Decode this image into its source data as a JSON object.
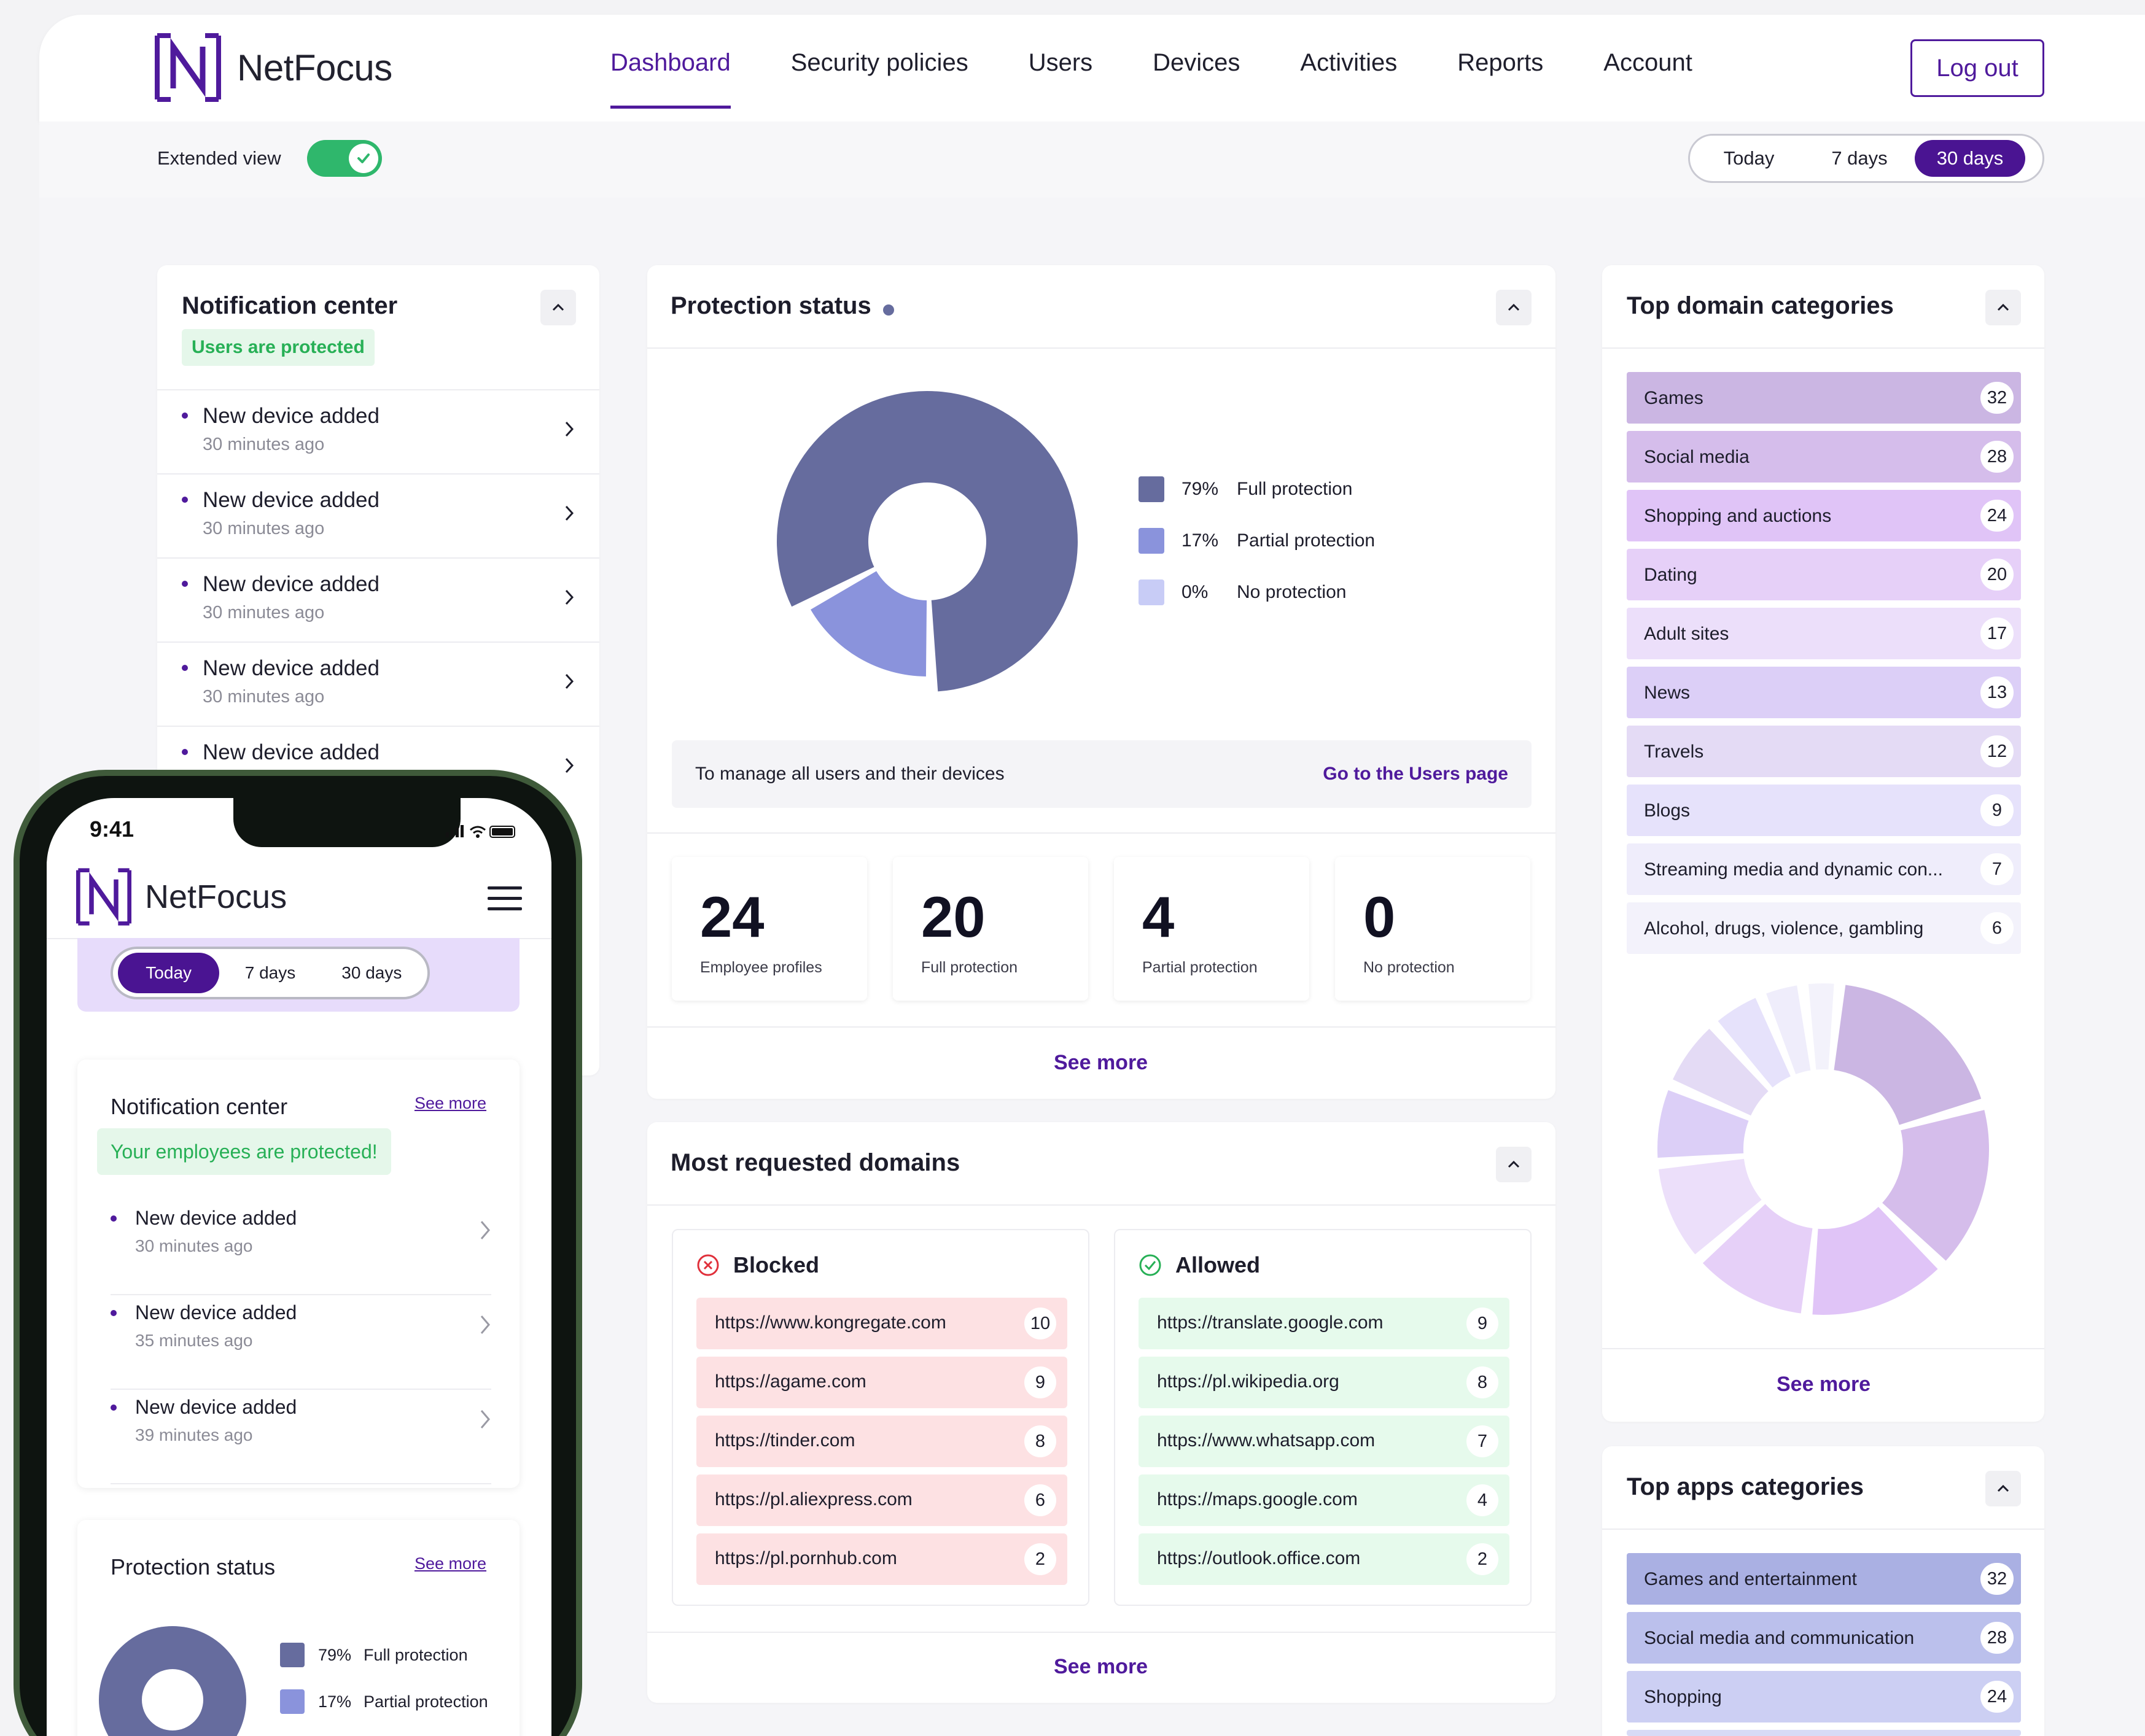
{
  "brand": {
    "name": "NetFocus",
    "accent": "#4f1a9c",
    "success": "#2fb76c"
  },
  "nav": {
    "items": [
      {
        "label": "Dashboard",
        "active": true
      },
      {
        "label": "Security policies"
      },
      {
        "label": "Users"
      },
      {
        "label": "Devices"
      },
      {
        "label": "Activities"
      },
      {
        "label": "Reports"
      },
      {
        "label": "Account"
      }
    ],
    "logout_label": "Log out"
  },
  "toolbar": {
    "extended_view_label": "Extended view",
    "extended_view_on": true,
    "ranges": [
      "Today",
      "7 days",
      "30 days"
    ],
    "selected_range": "30 days"
  },
  "notification_center": {
    "title": "Notification center",
    "badge": "Users are protected",
    "items": [
      {
        "title": "New device added",
        "time": "30 minutes ago"
      },
      {
        "title": "New device added",
        "time": "30 minutes ago"
      },
      {
        "title": "New device added",
        "time": "30 minutes ago"
      },
      {
        "title": "New device added",
        "time": "30 minutes ago"
      },
      {
        "title": "New device added",
        "time": ""
      }
    ]
  },
  "protection_status": {
    "title": "Protection status",
    "legend": [
      {
        "pct": "79%",
        "label": "Full protection",
        "color": "#666c9e"
      },
      {
        "pct": "17%",
        "label": "Partial protection",
        "color": "#8a93dc"
      },
      {
        "pct": "0%",
        "label": "No protection",
        "color": "#c8ccf6"
      }
    ],
    "manage_text": "To manage all users and their devices",
    "manage_link": "Go to the Users page",
    "stats": [
      {
        "value": "24",
        "label": "Employee profiles"
      },
      {
        "value": "20",
        "label": "Full protection"
      },
      {
        "value": "4",
        "label": "Partial protection"
      },
      {
        "value": "0",
        "label": "No protection"
      }
    ],
    "see_more": "See more"
  },
  "chart_data": {
    "type": "pie",
    "title": "",
    "series": [
      {
        "values": [
          79,
          17,
          0
        ],
        "categories": [
          "Full protection",
          "Partial protection",
          "No protection"
        ]
      }
    ]
  },
  "most_requested": {
    "title": "Most requested domains",
    "blocked": {
      "label": "Blocked",
      "rows": [
        {
          "url": "https://www.kongregate.com",
          "count": "10"
        },
        {
          "url": "https://agame.com",
          "count": "9"
        },
        {
          "url": "https://tinder.com",
          "count": "8"
        },
        {
          "url": "https://pl.aliexpress.com",
          "count": "6"
        },
        {
          "url": "https://pl.pornhub.com",
          "count": "2"
        }
      ]
    },
    "allowed": {
      "label": "Allowed",
      "rows": [
        {
          "url": "https://translate.google.com",
          "count": "9"
        },
        {
          "url": "https://pl.wikipedia.org",
          "count": "8"
        },
        {
          "url": "https://www.whatsapp.com",
          "count": "7"
        },
        {
          "url": "https://maps.google.com",
          "count": "4"
        },
        {
          "url": "https://outlook.office.com",
          "count": "2"
        }
      ]
    },
    "see_more": "See more"
  },
  "top_domains": {
    "title": "Top domain categories",
    "rows": [
      {
        "label": "Games",
        "count": "32",
        "color": "#cbb6e3"
      },
      {
        "label": "Social media",
        "count": "28",
        "color": "#d5bdeb"
      },
      {
        "label": "Shopping and auctions",
        "count": "24",
        "color": "#e0c4f7"
      },
      {
        "label": "Dating",
        "count": "20",
        "color": "#e6d0f8"
      },
      {
        "label": "Adult sites",
        "count": "17",
        "color": "#ecdffa"
      },
      {
        "label": "News",
        "count": "13",
        "color": "#dccff7"
      },
      {
        "label": "Travels",
        "count": "12",
        "color": "#e4dbf5"
      },
      {
        "label": "Blogs",
        "count": "9",
        "color": "#e6e2fb"
      },
      {
        "label": "Streaming media and dynamic con...",
        "count": "7",
        "color": "#efedfb"
      },
      {
        "label": "Alcohol, drugs, violence, gambling",
        "count": "6",
        "color": "#f3f2fb"
      }
    ],
    "see_more": "See more"
  },
  "top_apps": {
    "title": "Top apps categories",
    "rows": [
      {
        "label": "Games and entertainment",
        "count": "32",
        "color": "#aab0e3"
      },
      {
        "label": "Social media and communication",
        "count": "28",
        "color": "#bbc0ec"
      },
      {
        "label": "Shopping",
        "count": "24",
        "color": "#cccff3"
      }
    ]
  },
  "phone": {
    "time": "9:41",
    "brand": "NetFocus",
    "ranges": [
      "Today",
      "7 days",
      "30 days"
    ],
    "selected_range": "Today",
    "notification": {
      "title": "Notification center",
      "see_more": "See more",
      "badge": "Your employees are protected!",
      "items": [
        {
          "title": "New device added",
          "time": "30 minutes ago"
        },
        {
          "title": "New device added",
          "time": "35 minutes ago"
        },
        {
          "title": "New device added",
          "time": "39 minutes ago"
        }
      ]
    },
    "protection": {
      "title": "Protection status",
      "see_more": "See more",
      "legend": [
        {
          "pct": "79%",
          "label": "Full protection",
          "color": "#666c9e"
        },
        {
          "pct": "17%",
          "label": "Partial protection",
          "color": "#8a93dc"
        }
      ]
    }
  }
}
